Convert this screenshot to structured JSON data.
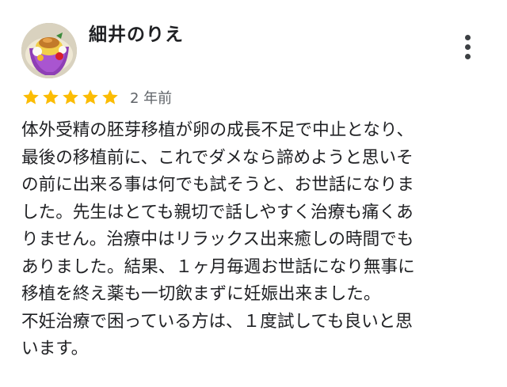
{
  "review": {
    "author": "細井のりえ",
    "rating": 5,
    "rating_max": 5,
    "time": "2 年前",
    "text_lines": [
      "体外受精の胚芽移植が卵の成長不足で中止となり、",
      "最後の移植前に、これでダメなら諦めようと思いそ",
      "の前に出来る事は何でも試そうと、お世話になりま",
      "した。先生はとても親切で話しやすく治療も痛くあ",
      "りません。治療中はリラックス出来癒しの時間でも",
      "ありました。結果、１ヶ月毎週お世話になり無事に",
      "移植を終え薬も一切飲まずに妊娠出来ました。",
      "不妊治療で困っている方は、１度試しても良いと思",
      "います。"
    ]
  },
  "icons": {
    "avatar": "profile-photo-avatar",
    "more": "more-vert-icon",
    "star": "star-icon"
  },
  "colors": {
    "star": "#FBBC04",
    "text": "#202124",
    "secondary_text": "#5F6368",
    "icon": "#3C4043"
  }
}
